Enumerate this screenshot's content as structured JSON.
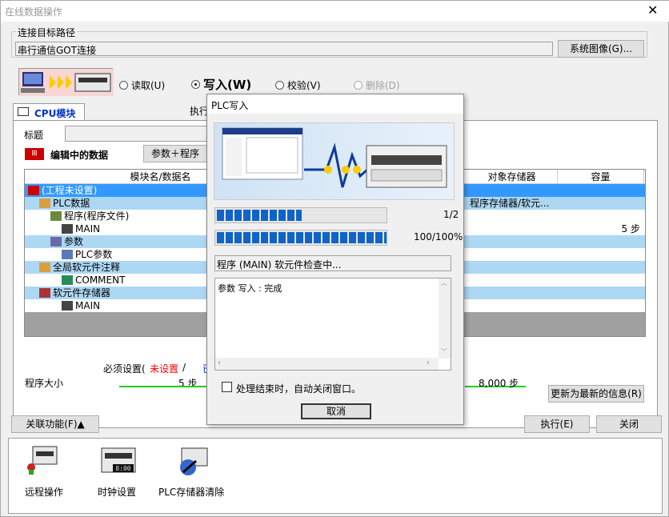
{
  "window": {
    "title": "在线数据操作"
  },
  "connection": {
    "group_label": "连接目标路径",
    "path": "串行通信GOT连接",
    "sys_image_button": "系统图像(G)..."
  },
  "mode": {
    "options": [
      {
        "label": "读取(U)"
      },
      {
        "label": "写入(W)"
      },
      {
        "label": "校验(V)"
      },
      {
        "label": "删除(D)"
      }
    ],
    "selected": "写入(W)"
  },
  "tabs": {
    "cpu": "CPU模块",
    "exec": "执行"
  },
  "main": {
    "title_label": "标题",
    "editing_label": "编辑中的数据",
    "param_button": "参数＋程序",
    "columns": [
      "模块名/数据名",
      "对象存储器",
      "容量"
    ],
    "rows": [
      {
        "name": "(工程未设置)",
        "target": "",
        "size": ""
      },
      {
        "name": "PLC数据",
        "target": "程序存储器/软元...",
        "size": ""
      },
      {
        "name": "程序(程序文件)",
        "target": "",
        "size": ""
      },
      {
        "name": "MAIN",
        "target": "",
        "size": "5 步"
      },
      {
        "name": "参数",
        "target": "",
        "size": ""
      },
      {
        "name": "PLC参数",
        "target": "",
        "size": ""
      },
      {
        "name": "全局软元件注释",
        "target": "",
        "size": ""
      },
      {
        "name": "COMMENT",
        "target": "",
        "size": ""
      },
      {
        "name": "软元件存储器",
        "target": "",
        "size": ""
      },
      {
        "name": "MAIN",
        "target": "",
        "size": ""
      }
    ],
    "required_setting": "必须设置(",
    "not_set": "未设置",
    "slash": "/",
    "trailing": "已",
    "prog_size_label": "程序大小",
    "prog_size_value": "5 步",
    "capacity_value": "8,000 步",
    "refresh_button": "更新为最新的信息(R)"
  },
  "footer": {
    "related_button": "关联功能(F)▲",
    "execute_button": "执行(E)",
    "close_button": "关闭"
  },
  "tools": [
    {
      "label": "远程操作"
    },
    {
      "label": "时钟设置"
    },
    {
      "label": "PLC存储器清除"
    }
  ],
  "dialog": {
    "title": "PLC写入",
    "progress1_text": "1/2",
    "progress1": 0.5,
    "progress2_text": "100/100%",
    "progress2": 1.0,
    "status": "程序 (MAIN) 软元件检查中...",
    "log": "参数 写入 : 完成",
    "auto_close_label": "处理结束时，自动关闭窗口。",
    "cancel_button": "取消"
  },
  "colors": {
    "selected_row": "#3399ff",
    "alt_row": "#add8f3",
    "progress": "#0f64c8",
    "not_set": "#ff0000"
  }
}
